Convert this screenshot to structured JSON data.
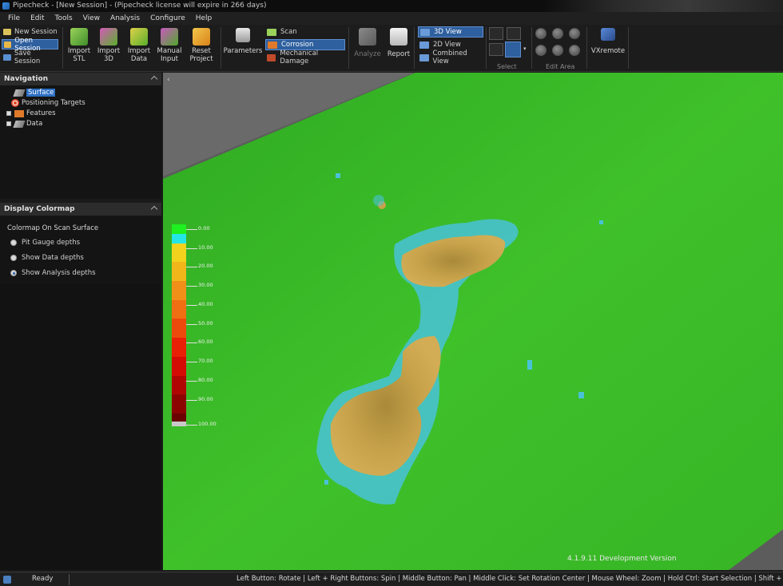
{
  "window": {
    "title": "Pipecheck - [New Session] - (Pipecheck license will expire in 266 days)"
  },
  "menu": [
    "File",
    "Edit",
    "Tools",
    "View",
    "Analysis",
    "Configure",
    "Help"
  ],
  "ribbon": {
    "session": {
      "new": "New Session",
      "open": "Open Session",
      "save": "Save Session"
    },
    "import_stl": "Import\nSTL",
    "import_3d": "Import\n3D",
    "import_data": "Import\nData",
    "manual_input": "Manual\nInput",
    "reset_project": "Reset\nProject",
    "parameters": "Parameters",
    "scan": "Scan",
    "corrosion": "Corrosion",
    "mechanical_damage": "Mechanical Damage",
    "analyze": "Analyze",
    "report": "Report",
    "view_3d": "3D View",
    "view_2d": "2D View",
    "combined_view": "Combined View",
    "select_label": "Select",
    "edit_area_label": "Edit Area",
    "vxremote": "VXremote"
  },
  "navigation": {
    "header": "Navigation",
    "items": [
      {
        "label": "Surface",
        "selected": true
      },
      {
        "label": "Positioning Targets",
        "selected": false
      },
      {
        "label": "Features",
        "selected": false
      },
      {
        "label": "Data",
        "selected": false
      }
    ]
  },
  "colormap": {
    "header": "Display Colormap",
    "title": "Colormap On Scan Surface",
    "options": [
      {
        "label": "Pit Gauge depths",
        "selected": false
      },
      {
        "label": "Show Data depths",
        "selected": false
      },
      {
        "label": "Show Analysis depths",
        "selected": true
      }
    ]
  },
  "legend": {
    "colors": [
      "#1ff01f",
      "#25e6e6",
      "#f2d21c",
      "#f0b61a",
      "#f19018",
      "#ef6f12",
      "#ec4a0c",
      "#e82006",
      "#d40a04",
      "#b00603",
      "#8c0402",
      "#6a0201",
      "#c8c8c8"
    ],
    "labels": [
      "0.00",
      "10.00",
      "20.00",
      "30.00",
      "40.00",
      "50.00",
      "60.00",
      "70.00",
      "80.00",
      "90.00",
      "100.00"
    ]
  },
  "viewport": {
    "version": "4.1.9.11 Development Version"
  },
  "status": {
    "state": "Ready",
    "hints": "Left Button: Rotate | Left + Right Buttons: Spin | Middle Button: Pan | Middle Click: Set Rotation Center | Mouse Wheel: Zoom | Hold Ctrl: Start Selection | Shift + Left Button: Mes"
  }
}
